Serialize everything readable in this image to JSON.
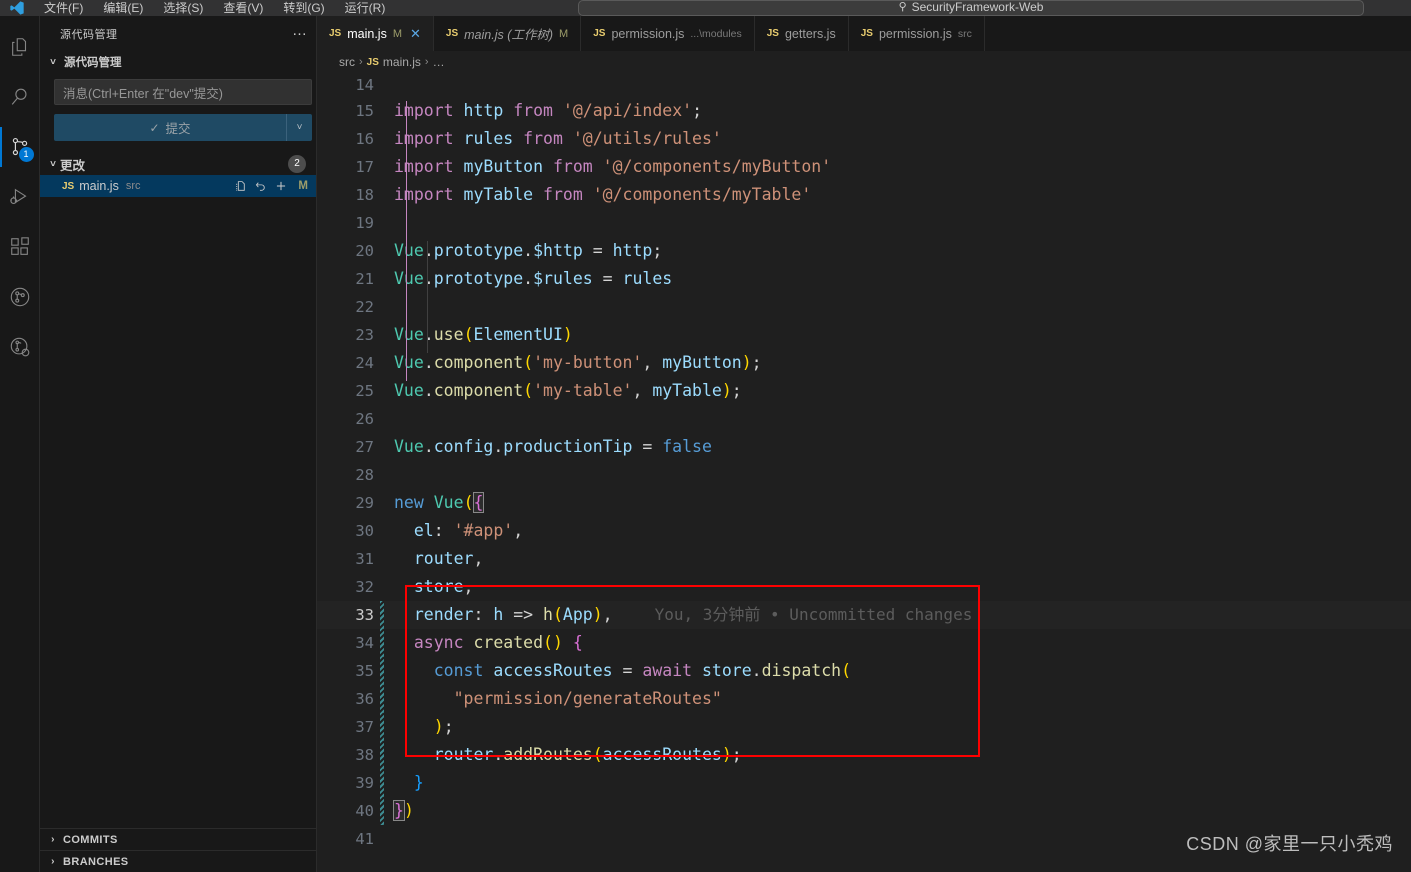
{
  "titlebar": {
    "menus": [
      "文件(F)",
      "编辑(E)",
      "选择(S)",
      "查看(V)",
      "转到(G)",
      "运行(R)"
    ],
    "search_icon": "search-icon",
    "search_text": "SecurityFramework-Web"
  },
  "activitybar": {
    "items": [
      {
        "name": "explorer",
        "icon": "files-icon",
        "active": false,
        "badge": ""
      },
      {
        "name": "search",
        "icon": "search-icon",
        "active": false,
        "badge": ""
      },
      {
        "name": "source-control",
        "icon": "source-control-icon",
        "active": true,
        "badge": "1"
      },
      {
        "name": "run-and-debug",
        "icon": "run-debug-icon",
        "active": false,
        "badge": ""
      },
      {
        "name": "extensions",
        "icon": "extensions-icon",
        "active": false,
        "badge": ""
      },
      {
        "name": "gitlens",
        "icon": "gitlens-icon",
        "active": false,
        "badge": ""
      },
      {
        "name": "gitlens-inspect",
        "icon": "gitlens-inspect-icon",
        "active": false,
        "badge": ""
      }
    ]
  },
  "sidebar": {
    "title": "源代码管理",
    "more_actions": "…",
    "section_label": "源代码管理",
    "commit_input_placeholder": "消息(Ctrl+Enter 在\"dev\"提交)",
    "commit_button_label": "提交",
    "commit_button_check": "✓",
    "commit_dropdown_icon": "chevron-down-icon",
    "changes_label": "更改",
    "changes_count": "2",
    "files": [
      {
        "icon": "js-file-icon",
        "icon_label": "JS",
        "name": "main.js",
        "description": "src",
        "status": "M",
        "actions": [
          "open-file-icon",
          "discard-changes-icon",
          "stage-changes-icon"
        ]
      }
    ],
    "footer": [
      {
        "label": "COMMITS",
        "icon": "chevron-right-icon"
      },
      {
        "label": "BRANCHES",
        "icon": "chevron-right-icon"
      }
    ]
  },
  "editor": {
    "tabs": [
      {
        "icon_label": "JS",
        "name": "main.js",
        "description": "",
        "modified": "M",
        "active": true,
        "italic": false,
        "closable": true
      },
      {
        "icon_label": "JS",
        "name": "main.js (工作树)",
        "description": "",
        "modified": "M",
        "active": false,
        "italic": true,
        "closable": false
      },
      {
        "icon_label": "JS",
        "name": "permission.js",
        "description": "...\\modules",
        "modified": "",
        "active": false,
        "italic": false,
        "closable": false
      },
      {
        "icon_label": "JS",
        "name": "getters.js",
        "description": "",
        "modified": "",
        "active": false,
        "italic": false,
        "closable": false
      },
      {
        "icon_label": "JS",
        "name": "permission.js",
        "description": "src",
        "modified": "",
        "active": false,
        "italic": false,
        "closable": false
      }
    ],
    "breadcrumb": [
      "src",
      "main.js",
      "…"
    ],
    "breadcrumb_icon_label": "JS",
    "blame_annotation": "You, 3分钟前 • Uncommitted changes",
    "first_visible_line": "14",
    "lines": [
      {
        "n": "14",
        "text": ""
      },
      {
        "n": "15",
        "text": "import http from '@/api/index';"
      },
      {
        "n": "16",
        "text": "import rules from '@/utils/rules'"
      },
      {
        "n": "17",
        "text": "import myButton from '@/components/myButton'"
      },
      {
        "n": "18",
        "text": "import myTable from '@/components/myTable'"
      },
      {
        "n": "19",
        "text": ""
      },
      {
        "n": "20",
        "text": "Vue.prototype.$http = http;"
      },
      {
        "n": "21",
        "text": "Vue.prototype.$rules = rules"
      },
      {
        "n": "22",
        "text": ""
      },
      {
        "n": "23",
        "text": "Vue.use(ElementUI)"
      },
      {
        "n": "24",
        "text": "Vue.component('my-button', myButton);"
      },
      {
        "n": "25",
        "text": "Vue.component('my-table', myTable);",
        "breakpoint": true
      },
      {
        "n": "26",
        "text": ""
      },
      {
        "n": "27",
        "text": "Vue.config.productionTip = false"
      },
      {
        "n": "28",
        "text": ""
      },
      {
        "n": "29",
        "text": "new Vue({"
      },
      {
        "n": "30",
        "text": "  el: '#app',"
      },
      {
        "n": "31",
        "text": "  router,"
      },
      {
        "n": "32",
        "text": "  store,"
      },
      {
        "n": "33",
        "text": "  render: h => h(App),",
        "current": true
      },
      {
        "n": "34",
        "text": "  async created() {"
      },
      {
        "n": "35",
        "text": "    const accessRoutes = await store.dispatch("
      },
      {
        "n": "36",
        "text": "      \"permission/generateRoutes\""
      },
      {
        "n": "37",
        "text": "    );"
      },
      {
        "n": "38",
        "text": "    router.addRoutes(accessRoutes);"
      },
      {
        "n": "39",
        "text": "  }"
      },
      {
        "n": "40",
        "text": "})"
      },
      {
        "n": "41",
        "text": ""
      }
    ]
  },
  "annotation": {
    "redbox_color": "#fe0000"
  },
  "watermark": "CSDN @家里一只小秃鸡"
}
